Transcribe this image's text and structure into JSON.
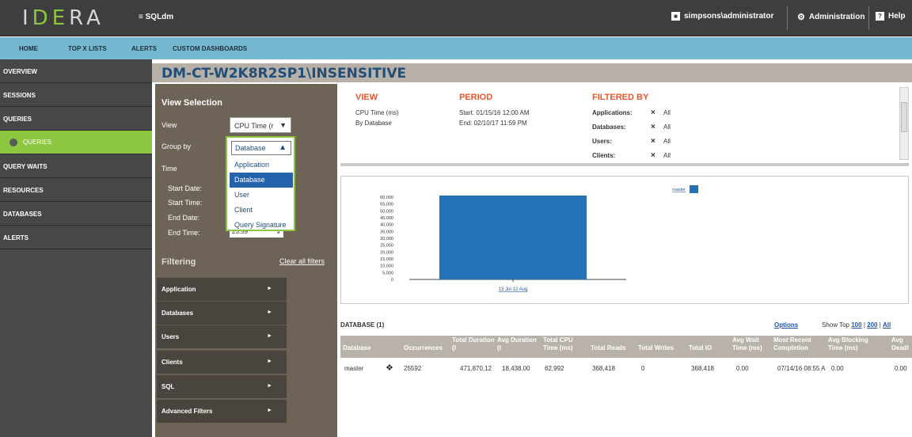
{
  "app": {
    "logo": "IDERA",
    "product": "SQLdm",
    "menu_glyph": "≡"
  },
  "topbar": {
    "user": "simpsons\\administrator",
    "admin": "Administration",
    "help": "Help"
  },
  "nav": [
    "HOME",
    "TOP X LISTS",
    "ALERTS",
    "CUSTOM DASHBOARDS"
  ],
  "sidebar": [
    {
      "label": "OVERVIEW"
    },
    {
      "label": "SESSIONS"
    },
    {
      "label": "QUERIES"
    },
    {
      "label": "QUERIES"
    },
    {
      "label": "QUERY WAITS"
    },
    {
      "label": "RESOURCES"
    },
    {
      "label": "DATABASES"
    },
    {
      "label": "ALERTS"
    }
  ],
  "page_title": "DM-CT-W2K8R2SP1\\INSENSITIVE",
  "view_selection": {
    "heading": "View Selection",
    "view_label": "View",
    "view_value": "CPU Time (r",
    "group_label": "Group by",
    "group_value": "Database",
    "group_options": [
      "Application",
      "Database",
      "User",
      "Client",
      "Query Signature"
    ],
    "time_label": "Time",
    "start_date": "Start Date:",
    "start_time": "Start Time:",
    "end_date": "End Date:",
    "end_time": "End Time:",
    "end_time_value": "23:59"
  },
  "filtering": {
    "heading": "Filtering",
    "clear_all": "Clear all filters",
    "groups": [
      "Application",
      "Databases",
      "Users",
      "Clients",
      "SQL",
      "Advanced Filters"
    ]
  },
  "summary": {
    "view_heading": "VIEW",
    "view_line1": "CPU Time (ms)",
    "view_line2": "By Database",
    "period_heading": "PERIOD",
    "period_start": "Start: 01/15/16 12:00 AM",
    "period_end": "End: 02/10/17 11:59 PM",
    "filtered_heading": "FILTERED BY",
    "filters": [
      {
        "label": "Applications:",
        "value": "All"
      },
      {
        "label": "Databases:",
        "value": "All"
      },
      {
        "label": "Users:",
        "value": "All"
      },
      {
        "label": "Clients:",
        "value": "All"
      }
    ]
  },
  "chart_data": {
    "type": "bar",
    "categories": [
      "13 Jul-12 Aug"
    ],
    "series": [
      {
        "name": "master",
        "values": [
          62992
        ]
      }
    ],
    "yticks": [
      "60,000",
      "55,000",
      "50,000",
      "45,000",
      "40,000",
      "35,000",
      "30,000",
      "25,000",
      "20,000",
      "15,000",
      "10,000",
      "5,000",
      "0"
    ],
    "ylim": [
      0,
      60000
    ],
    "legend": "top-right",
    "color": "#2471b5"
  },
  "grid": {
    "title": "DATABASE (1)",
    "options": "Options",
    "show_top": "Show Top",
    "top_links": [
      "100",
      "200",
      "All"
    ],
    "columns": [
      "Database",
      "Occurrences",
      "Total Duration (I",
      "Avg Duration (I",
      "Total CPU Time (ms)",
      "Total Reads",
      "Total Writes",
      "Total IO",
      "Avg Wait Time (ms)",
      "Most Recent Completion",
      "Avg Blocking Time (ms)",
      "Avg Deadl"
    ],
    "rows": [
      [
        "master",
        "25592",
        "471,870,12",
        "18,438.00",
        "62,992",
        "368,418",
        "0",
        "368,418",
        "0.00",
        "07/14/16 08:55 A",
        "0.00",
        "0.00"
      ]
    ]
  }
}
